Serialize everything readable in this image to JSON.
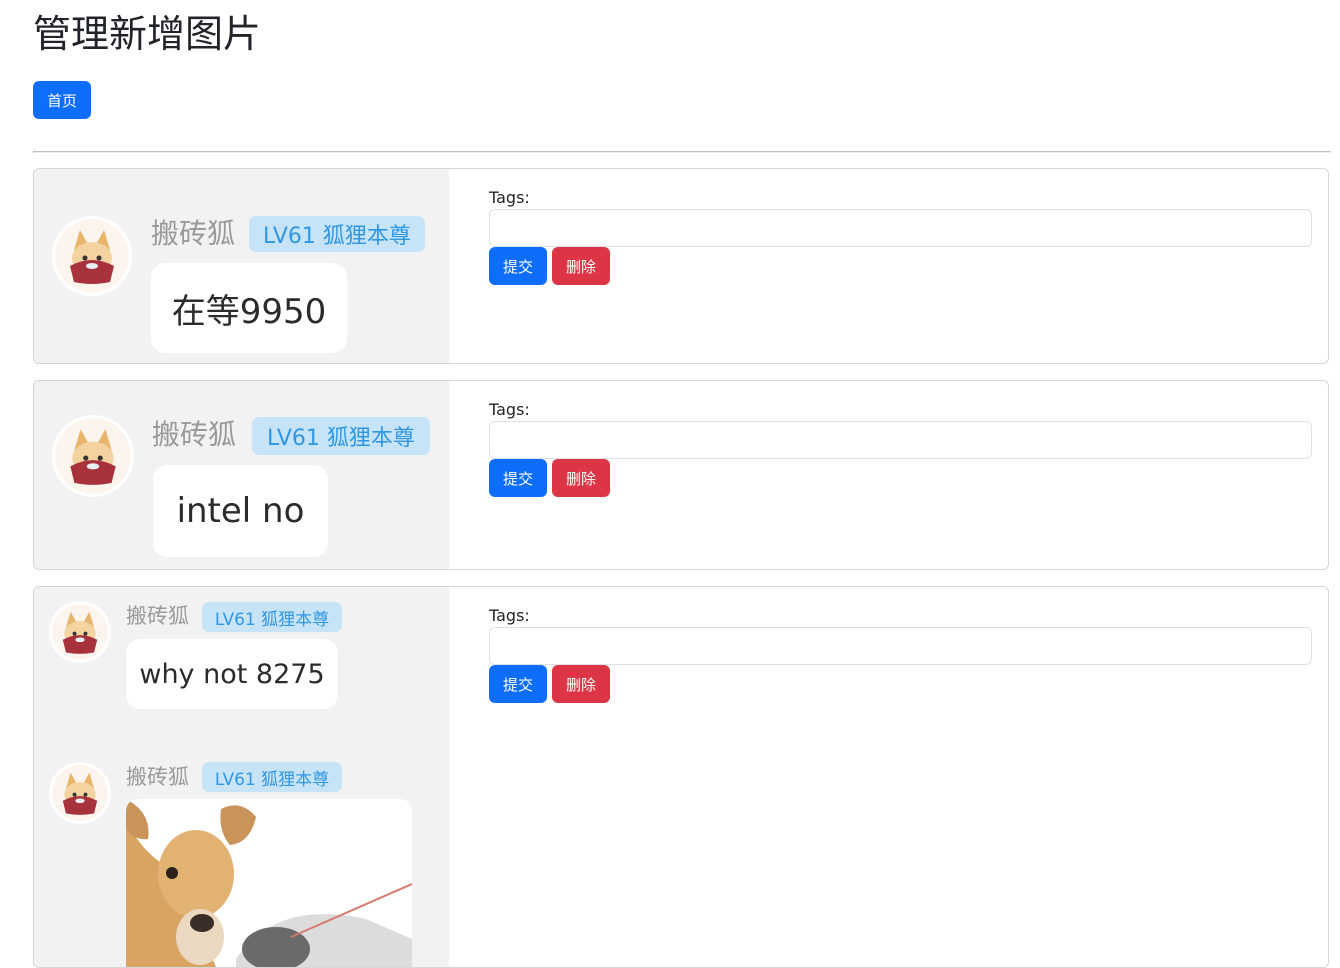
{
  "page": {
    "title": "管理新增图片",
    "home_label": "首页"
  },
  "colors": {
    "primary": "#0d6efd",
    "danger": "#dc3545",
    "badge_bg": "#c7e3f7",
    "badge_text": "#2f97e4",
    "thumb_bg": "#f2f2f2"
  },
  "form": {
    "tags_label": "Tags:",
    "tags_value": "",
    "submit_label": "提交",
    "delete_label": "删除"
  },
  "entries": [
    {
      "messages": [
        {
          "user": "搬砖狐",
          "badge": "LV61 狐狸本尊",
          "text": "在等9950"
        }
      ]
    },
    {
      "messages": [
        {
          "user": "搬砖狐",
          "badge": "LV61 狐狸本尊",
          "text": "intel no"
        }
      ]
    },
    {
      "messages": [
        {
          "user": "搬砖狐",
          "badge": "LV61 狐狸本尊",
          "text": "why not 8275"
        },
        {
          "user": "搬砖狐",
          "badge": "LV61 狐狸本尊",
          "image": "deer-photo"
        }
      ]
    }
  ]
}
